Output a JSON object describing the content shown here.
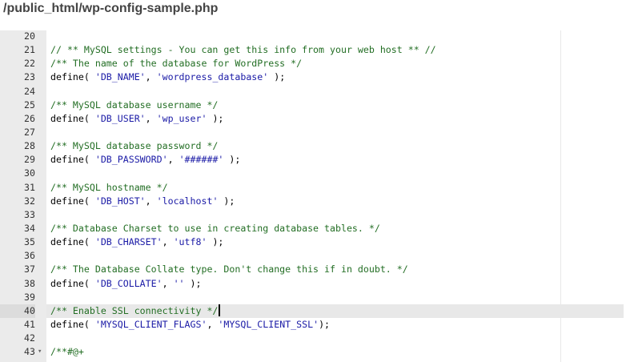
{
  "header": {
    "file_path": "/public_html/wp-config-sample.php"
  },
  "editor": {
    "active_line": 40,
    "lines": [
      {
        "num": "20",
        "tokens": []
      },
      {
        "num": "21",
        "tokens": [
          {
            "t": "comment",
            "v": "// ** MySQL settings - You can get this info from your web host ** //"
          }
        ]
      },
      {
        "num": "22",
        "tokens": [
          {
            "t": "comment",
            "v": "/** The name of the database for WordPress */"
          }
        ]
      },
      {
        "num": "23",
        "tokens": [
          {
            "t": "plain",
            "v": "define( "
          },
          {
            "t": "string",
            "v": "'DB_NAME'"
          },
          {
            "t": "plain",
            "v": ", "
          },
          {
            "t": "string",
            "v": "'wordpress_database'"
          },
          {
            "t": "plain",
            "v": " );"
          }
        ]
      },
      {
        "num": "24",
        "tokens": []
      },
      {
        "num": "25",
        "tokens": [
          {
            "t": "comment",
            "v": "/** MySQL database username */"
          }
        ]
      },
      {
        "num": "26",
        "tokens": [
          {
            "t": "plain",
            "v": "define( "
          },
          {
            "t": "string",
            "v": "'DB_USER'"
          },
          {
            "t": "plain",
            "v": ", "
          },
          {
            "t": "string",
            "v": "'wp_user'"
          },
          {
            "t": "plain",
            "v": " );"
          }
        ]
      },
      {
        "num": "27",
        "tokens": []
      },
      {
        "num": "28",
        "tokens": [
          {
            "t": "comment",
            "v": "/** MySQL database password */"
          }
        ]
      },
      {
        "num": "29",
        "tokens": [
          {
            "t": "plain",
            "v": "define( "
          },
          {
            "t": "string",
            "v": "'DB_PASSWORD'"
          },
          {
            "t": "plain",
            "v": ", "
          },
          {
            "t": "string",
            "v": "'######'"
          },
          {
            "t": "plain",
            "v": " );"
          }
        ]
      },
      {
        "num": "30",
        "tokens": []
      },
      {
        "num": "31",
        "tokens": [
          {
            "t": "comment",
            "v": "/** MySQL hostname */"
          }
        ]
      },
      {
        "num": "32",
        "tokens": [
          {
            "t": "plain",
            "v": "define( "
          },
          {
            "t": "string",
            "v": "'DB_HOST'"
          },
          {
            "t": "plain",
            "v": ", "
          },
          {
            "t": "string",
            "v": "'localhost'"
          },
          {
            "t": "plain",
            "v": " );"
          }
        ]
      },
      {
        "num": "33",
        "tokens": []
      },
      {
        "num": "34",
        "tokens": [
          {
            "t": "comment",
            "v": "/** Database Charset to use in creating database tables. */"
          }
        ]
      },
      {
        "num": "35",
        "tokens": [
          {
            "t": "plain",
            "v": "define( "
          },
          {
            "t": "string",
            "v": "'DB_CHARSET'"
          },
          {
            "t": "plain",
            "v": ", "
          },
          {
            "t": "string",
            "v": "'utf8'"
          },
          {
            "t": "plain",
            "v": " );"
          }
        ]
      },
      {
        "num": "36",
        "tokens": []
      },
      {
        "num": "37",
        "tokens": [
          {
            "t": "comment",
            "v": "/** The Database Collate type. Don't change this if in doubt. */"
          }
        ]
      },
      {
        "num": "38",
        "tokens": [
          {
            "t": "plain",
            "v": "define( "
          },
          {
            "t": "string",
            "v": "'DB_COLLATE'"
          },
          {
            "t": "plain",
            "v": ", "
          },
          {
            "t": "string",
            "v": "''"
          },
          {
            "t": "plain",
            "v": " );"
          }
        ]
      },
      {
        "num": "39",
        "tokens": []
      },
      {
        "num": "40",
        "tokens": [
          {
            "t": "comment",
            "v": "/** Enable SSL connectivity */"
          }
        ],
        "cursor": true
      },
      {
        "num": "41",
        "tokens": [
          {
            "t": "plain",
            "v": "define( "
          },
          {
            "t": "string",
            "v": "'MYSQL_CLIENT_FLAGS'"
          },
          {
            "t": "plain",
            "v": ", "
          },
          {
            "t": "string",
            "v": "'MYSQL_CLIENT_SSL'"
          },
          {
            "t": "plain",
            "v": ");"
          }
        ]
      },
      {
        "num": "42",
        "tokens": []
      },
      {
        "num": "43",
        "fold": "▾",
        "tokens": [
          {
            "t": "comment",
            "v": "/**#@+"
          }
        ]
      }
    ]
  },
  "colors": {
    "comment": "#236e24",
    "string": "#1a1aa6",
    "gutter": "#ebebeb",
    "active_line": "#e8e8e8"
  }
}
